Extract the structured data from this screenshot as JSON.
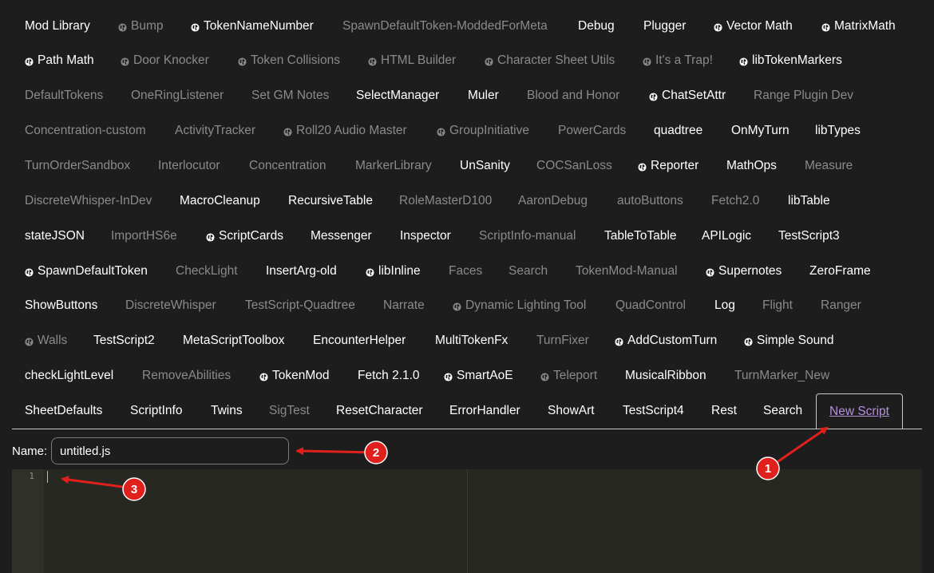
{
  "tabs": [
    {
      "label": "Mod Library",
      "active": true,
      "globe": false
    },
    {
      "label": "Bump",
      "active": false,
      "globe": true
    },
    {
      "label": "TokenNameNumber",
      "active": true,
      "globe": true
    },
    {
      "label": "SpawnDefaultToken-ModdedForMeta",
      "active": false,
      "globe": false
    },
    {
      "label": "Debug",
      "active": true,
      "globe": false
    },
    {
      "label": "Plugger",
      "active": true,
      "globe": false
    },
    {
      "label": "Vector Math",
      "active": true,
      "globe": true
    },
    {
      "label": "MatrixMath",
      "active": true,
      "globe": true
    },
    {
      "label": "Path Math",
      "active": true,
      "globe": true
    },
    {
      "label": "Door Knocker",
      "active": false,
      "globe": true
    },
    {
      "label": "Token Collisions",
      "active": false,
      "globe": true
    },
    {
      "label": "HTML Builder",
      "active": false,
      "globe": true
    },
    {
      "label": "Character Sheet Utils",
      "active": false,
      "globe": true
    },
    {
      "label": "It's a Trap!",
      "active": false,
      "globe": true
    },
    {
      "label": "libTokenMarkers",
      "active": true,
      "globe": true
    },
    {
      "label": "DefaultTokens",
      "active": false,
      "globe": false
    },
    {
      "label": "OneRingListener",
      "active": false,
      "globe": false
    },
    {
      "label": "Set GM Notes",
      "active": false,
      "globe": false
    },
    {
      "label": "SelectManager",
      "active": true,
      "globe": false
    },
    {
      "label": "Muler",
      "active": true,
      "globe": false
    },
    {
      "label": "Blood and Honor",
      "active": false,
      "globe": false
    },
    {
      "label": "ChatSetAttr",
      "active": true,
      "globe": true
    },
    {
      "label": "Range Plugin Dev",
      "active": false,
      "globe": false
    },
    {
      "label": "Concentration-custom",
      "active": false,
      "globe": false
    },
    {
      "label": "ActivityTracker",
      "active": false,
      "globe": false
    },
    {
      "label": "Roll20 Audio Master",
      "active": false,
      "globe": true
    },
    {
      "label": "GroupInitiative",
      "active": false,
      "globe": true
    },
    {
      "label": "PowerCards",
      "active": false,
      "globe": false
    },
    {
      "label": "quadtree",
      "active": true,
      "globe": false
    },
    {
      "label": "OnMyTurn",
      "active": true,
      "globe": false
    },
    {
      "label": "libTypes",
      "active": true,
      "globe": false
    },
    {
      "label": "TurnOrderSandbox",
      "active": false,
      "globe": false
    },
    {
      "label": "Interlocutor",
      "active": false,
      "globe": false
    },
    {
      "label": "Concentration",
      "active": false,
      "globe": false
    },
    {
      "label": "MarkerLibrary",
      "active": false,
      "globe": false
    },
    {
      "label": "UnSanity",
      "active": true,
      "globe": false
    },
    {
      "label": "COCSanLoss",
      "active": false,
      "globe": false
    },
    {
      "label": "Reporter",
      "active": true,
      "globe": true
    },
    {
      "label": "MathOps",
      "active": true,
      "globe": false
    },
    {
      "label": "Measure",
      "active": false,
      "globe": false
    },
    {
      "label": "DiscreteWhisper-InDev",
      "active": false,
      "globe": false
    },
    {
      "label": "MacroCleanup",
      "active": true,
      "globe": false
    },
    {
      "label": "RecursiveTable",
      "active": true,
      "globe": false
    },
    {
      "label": "RoleMasterD100",
      "active": false,
      "globe": false
    },
    {
      "label": "AaronDebug",
      "active": false,
      "globe": false
    },
    {
      "label": "autoButtons",
      "active": false,
      "globe": false
    },
    {
      "label": "Fetch2.0",
      "active": false,
      "globe": false
    },
    {
      "label": "libTable",
      "active": true,
      "globe": false
    },
    {
      "label": "stateJSON",
      "active": true,
      "globe": false
    },
    {
      "label": "ImportHS6e",
      "active": false,
      "globe": false
    },
    {
      "label": "ScriptCards",
      "active": true,
      "globe": true
    },
    {
      "label": "Messenger",
      "active": true,
      "globe": false
    },
    {
      "label": "Inspector",
      "active": true,
      "globe": false
    },
    {
      "label": "ScriptInfo-manual",
      "active": false,
      "globe": false
    },
    {
      "label": "TableToTable",
      "active": true,
      "globe": false
    },
    {
      "label": "APILogic",
      "active": true,
      "globe": false
    },
    {
      "label": "TestScript3",
      "active": true,
      "globe": false
    },
    {
      "label": "SpawnDefaultToken",
      "active": true,
      "globe": true
    },
    {
      "label": "CheckLight",
      "active": false,
      "globe": false
    },
    {
      "label": "InsertArg-old",
      "active": true,
      "globe": false
    },
    {
      "label": "libInline",
      "active": true,
      "globe": true
    },
    {
      "label": "Faces",
      "active": false,
      "globe": false
    },
    {
      "label": "Search",
      "active": false,
      "globe": false
    },
    {
      "label": "TokenMod-Manual",
      "active": false,
      "globe": false
    },
    {
      "label": "Supernotes",
      "active": true,
      "globe": true
    },
    {
      "label": "ZeroFrame",
      "active": true,
      "globe": false
    },
    {
      "label": "ShowButtons",
      "active": true,
      "globe": false
    },
    {
      "label": "DiscreteWhisper",
      "active": false,
      "globe": false
    },
    {
      "label": "TestScript-Quadtree",
      "active": false,
      "globe": false
    },
    {
      "label": "Narrate",
      "active": false,
      "globe": false
    },
    {
      "label": "Dynamic Lighting Tool",
      "active": false,
      "globe": true
    },
    {
      "label": "QuadControl",
      "active": false,
      "globe": false
    },
    {
      "label": "Log",
      "active": true,
      "globe": false
    },
    {
      "label": "Flight",
      "active": false,
      "globe": false
    },
    {
      "label": "Ranger",
      "active": false,
      "globe": false
    },
    {
      "label": "Walls",
      "active": false,
      "globe": true
    },
    {
      "label": "TestScript2",
      "active": true,
      "globe": false
    },
    {
      "label": "MetaScriptToolbox",
      "active": true,
      "globe": false
    },
    {
      "label": "EncounterHelper",
      "active": true,
      "globe": false
    },
    {
      "label": "MultiTokenFx",
      "active": true,
      "globe": false
    },
    {
      "label": "TurnFixer",
      "active": false,
      "globe": false
    },
    {
      "label": "AddCustomTurn",
      "active": true,
      "globe": true
    },
    {
      "label": "Simple Sound",
      "active": true,
      "globe": true
    },
    {
      "label": "checkLightLevel",
      "active": true,
      "globe": false
    },
    {
      "label": "RemoveAbilities",
      "active": false,
      "globe": false
    },
    {
      "label": "TokenMod",
      "active": true,
      "globe": true
    },
    {
      "label": "Fetch 2.1.0",
      "active": true,
      "globe": false
    },
    {
      "label": "SmartAoE",
      "active": true,
      "globe": true
    },
    {
      "label": "Teleport",
      "active": false,
      "globe": true
    },
    {
      "label": "MusicalRibbon",
      "active": true,
      "globe": false
    },
    {
      "label": "TurnMarker_New",
      "active": false,
      "globe": false
    },
    {
      "label": "SheetDefaults",
      "active": true,
      "globe": false
    },
    {
      "label": "ScriptInfo",
      "active": true,
      "globe": false
    },
    {
      "label": "Twins",
      "active": true,
      "globe": false
    },
    {
      "label": "SigTest",
      "active": false,
      "globe": false
    },
    {
      "label": "ResetCharacter",
      "active": true,
      "globe": false
    },
    {
      "label": "ErrorHandler",
      "active": true,
      "globe": false
    },
    {
      "label": "ShowArt",
      "active": true,
      "globe": false
    },
    {
      "label": "TestScript4",
      "active": true,
      "globe": false
    },
    {
      "label": "Rest",
      "active": true,
      "globe": false
    },
    {
      "label": "Search",
      "active": true,
      "globe": false
    }
  ],
  "new_script_label": "New Script",
  "name_label": "Name:",
  "name_value": "untitled.js",
  "editor": {
    "line_number": "1"
  },
  "annotations": [
    "1",
    "2",
    "3"
  ],
  "colors": {
    "annotation_red": "#e0201c",
    "link_purple": "#b58fd9",
    "bg": "#1d1d1d"
  },
  "icons": {
    "globe": "globe-icon"
  }
}
